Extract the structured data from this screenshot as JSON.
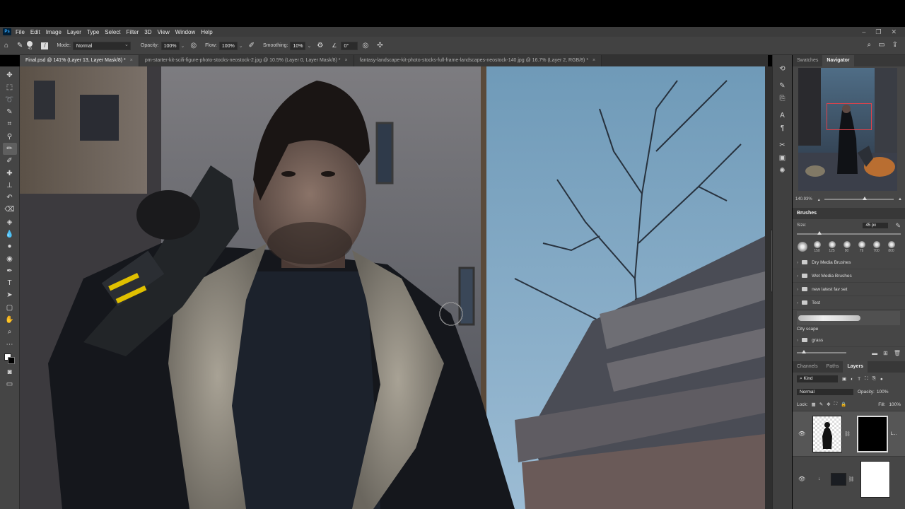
{
  "menu": {
    "logo": "Ps",
    "items": [
      "File",
      "Edit",
      "Image",
      "Layer",
      "Type",
      "Select",
      "Filter",
      "3D",
      "View",
      "Window",
      "Help"
    ]
  },
  "options": {
    "brush_size": "45",
    "mode_label": "Mode:",
    "mode_value": "Normal",
    "opacity_label": "Opacity:",
    "opacity_value": "100%",
    "flow_label": "Flow:",
    "flow_value": "100%",
    "smoothing_label": "Smoothing:",
    "smoothing_value": "10%",
    "angle_value": "0°"
  },
  "tabs": [
    {
      "label": "Final.psd @ 141% (Layer 13, Layer Mask/8) *"
    },
    {
      "label": "pm-starter-kit-scifi-figure-photo-stocks-neostock-2.jpg @ 10.5% (Layer 0, Layer Mask/8) *"
    },
    {
      "label": "fantasy-landscape-kit-photo-stocks-full-frame-landscapes-neostock-140.jpg @ 16.7% (Layer 2, RGB/8) *"
    }
  ],
  "navigator": {
    "tabs": [
      "Swatches",
      "Navigator"
    ],
    "zoom": "140.93%"
  },
  "brushes": {
    "title": "Brushes",
    "size_label": "Size:",
    "size_value": "45 px",
    "presets": [
      "150",
      "125",
      "90",
      "79",
      "700",
      "800"
    ],
    "folders": [
      "Dry Media Brushes",
      "Wet Media Brushes",
      "new latest fav set",
      "Test"
    ],
    "stroke_name": "City scape",
    "last_folder": "grass"
  },
  "layers": {
    "tabs": [
      "Channels",
      "Paths",
      "Layers"
    ],
    "kind_label": "Kind",
    "blend_mode": "Normal",
    "opacity_label": "Opacity:",
    "opacity_value": "100%",
    "lock_label": "Lock:",
    "fill_label": "Fill:",
    "fill_value": "100%",
    "layer1_name": "L..."
  },
  "colors": {
    "accent": "#31a8ff",
    "nav_viewbox": "#e0424a"
  }
}
